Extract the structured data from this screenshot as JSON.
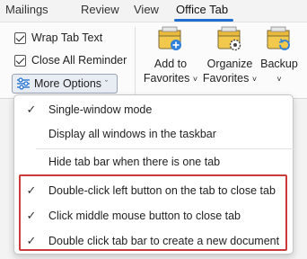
{
  "tabs": [
    {
      "label": "Mailings"
    },
    {
      "label": "Review"
    },
    {
      "label": "View"
    },
    {
      "label": "Office Tab"
    }
  ],
  "ribbon": {
    "checkboxes": [
      {
        "label": "Wrap Tab Text",
        "checked": true
      },
      {
        "label": "Close All Reminder",
        "checked": true
      }
    ],
    "more_options": {
      "label": "More Options",
      "caret": "ˇ"
    },
    "buttons": [
      {
        "line1": "Add to",
        "line2": "Favorites",
        "icon": "folder-add-icon"
      },
      {
        "line1": "Organize",
        "line2": "Favorites",
        "icon": "folder-gear-icon"
      },
      {
        "line1": "Backup",
        "line2": "",
        "icon": "folder-refresh-icon"
      }
    ]
  },
  "menu": {
    "items": [
      {
        "label": "Single-window mode",
        "checked": true
      },
      {
        "label": "Display all windows in the taskbar",
        "checked": false
      },
      {
        "label": "Hide tab bar when there is one tab",
        "checked": false
      },
      {
        "label": "Double-click left button on the tab to close tab",
        "checked": true
      },
      {
        "label": "Click middle mouse button to close tab",
        "checked": true
      },
      {
        "label": "Double click tab bar to create a new document",
        "checked": true
      }
    ]
  },
  "colors": {
    "accent": "#1e6fd0",
    "highlight_border": "#cc3a3a",
    "folder_yellow": "#f2c94c"
  }
}
